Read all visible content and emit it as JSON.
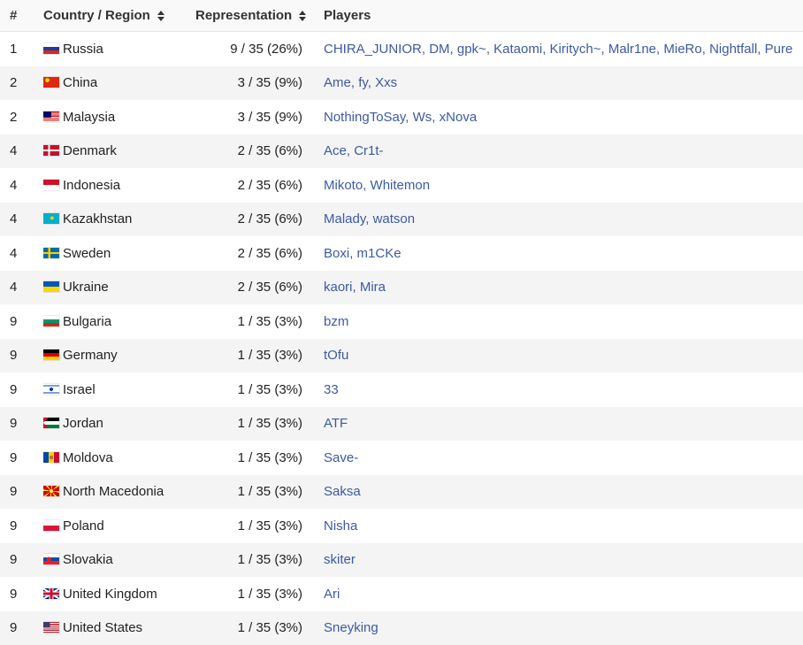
{
  "header": {
    "rank": "#",
    "country": "Country / Region",
    "representation": "Representation",
    "players": "Players"
  },
  "rows": [
    {
      "rank": "1",
      "country": "Russia",
      "flag": "russia-flag",
      "rep": "9 / 35 (26%)",
      "players": [
        "CHIRA_JUNIOR",
        "DM",
        "gpk~",
        "Kataomi",
        "Kiritych~",
        "Malr1ne",
        "MieRo",
        "Nightfall",
        "Pure"
      ]
    },
    {
      "rank": "2",
      "country": "China",
      "flag": "china-flag",
      "rep": "3 / 35 (9%)",
      "players": [
        "Ame",
        "fy",
        "Xxs"
      ]
    },
    {
      "rank": "2",
      "country": "Malaysia",
      "flag": "malaysia-flag",
      "rep": "3 / 35 (9%)",
      "players": [
        "NothingToSay",
        "Ws",
        "xNova"
      ]
    },
    {
      "rank": "4",
      "country": "Denmark",
      "flag": "denmark-flag",
      "rep": "2 / 35 (6%)",
      "players": [
        "Ace",
        "Cr1t-"
      ]
    },
    {
      "rank": "4",
      "country": "Indonesia",
      "flag": "indonesia-flag",
      "rep": "2 / 35 (6%)",
      "players": [
        "Mikoto",
        "Whitemon"
      ]
    },
    {
      "rank": "4",
      "country": "Kazakhstan",
      "flag": "kazakhstan-flag",
      "rep": "2 / 35 (6%)",
      "players": [
        "Malady",
        "watson"
      ]
    },
    {
      "rank": "4",
      "country": "Sweden",
      "flag": "sweden-flag",
      "rep": "2 / 35 (6%)",
      "players": [
        "Boxi",
        "m1CKe"
      ]
    },
    {
      "rank": "4",
      "country": "Ukraine",
      "flag": "ukraine-flag",
      "rep": "2 / 35 (6%)",
      "players": [
        "kaori",
        "Mira"
      ]
    },
    {
      "rank": "9",
      "country": "Bulgaria",
      "flag": "bulgaria-flag",
      "rep": "1 / 35 (3%)",
      "players": [
        "bzm"
      ]
    },
    {
      "rank": "9",
      "country": "Germany",
      "flag": "germany-flag",
      "rep": "1 / 35 (3%)",
      "players": [
        "tOfu"
      ]
    },
    {
      "rank": "9",
      "country": "Israel",
      "flag": "israel-flag",
      "rep": "1 / 35 (3%)",
      "players": [
        "33"
      ]
    },
    {
      "rank": "9",
      "country": "Jordan",
      "flag": "jordan-flag",
      "rep": "1 / 35 (3%)",
      "players": [
        "ATF"
      ]
    },
    {
      "rank": "9",
      "country": "Moldova",
      "flag": "moldova-flag",
      "rep": "1 / 35 (3%)",
      "players": [
        "Save-"
      ]
    },
    {
      "rank": "9",
      "country": "North Macedonia",
      "flag": "north-macedonia-flag",
      "rep": "1 / 35 (3%)",
      "players": [
        "Saksa"
      ]
    },
    {
      "rank": "9",
      "country": "Poland",
      "flag": "poland-flag",
      "rep": "1 / 35 (3%)",
      "players": [
        "Nisha"
      ]
    },
    {
      "rank": "9",
      "country": "Slovakia",
      "flag": "slovakia-flag",
      "rep": "1 / 35 (3%)",
      "players": [
        "skiter"
      ]
    },
    {
      "rank": "9",
      "country": "United Kingdom",
      "flag": "united-kingdom-flag",
      "rep": "1 / 35 (3%)",
      "players": [
        "Ari"
      ]
    },
    {
      "rank": "9",
      "country": "United States",
      "flag": "united-states-flag",
      "rep": "1 / 35 (3%)",
      "players": [
        "Sneyking"
      ]
    }
  ],
  "colors": {
    "link": "#3b5aa6",
    "row_alt": "#f4f4f4",
    "header_bg": "#f9f9f9"
  }
}
